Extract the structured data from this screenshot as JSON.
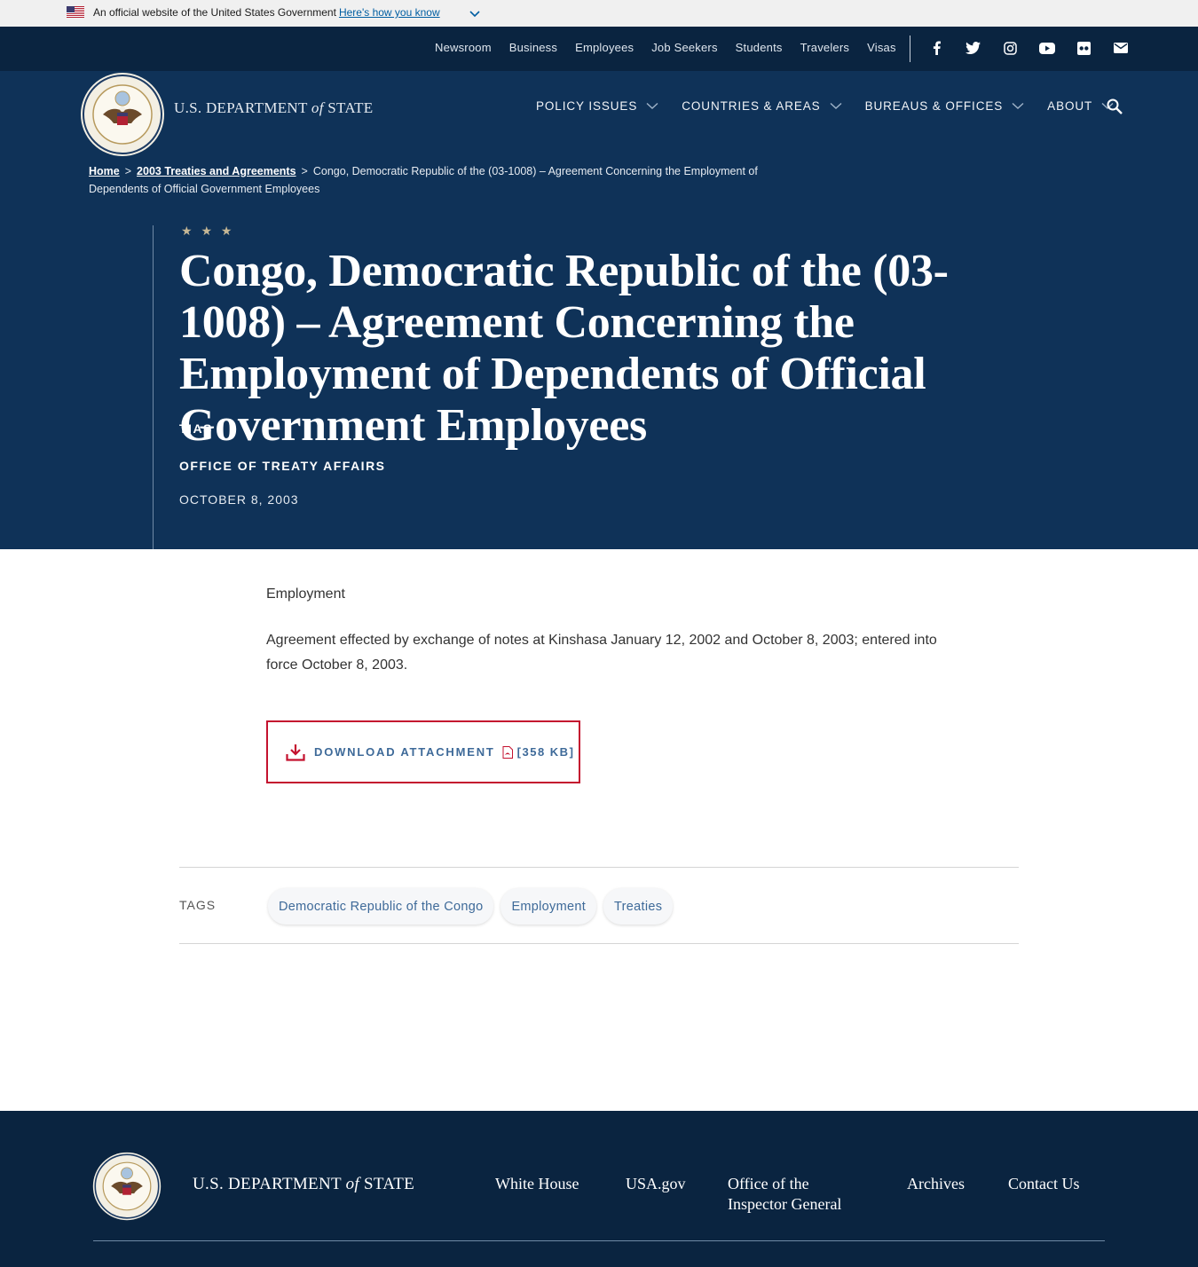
{
  "banner": {
    "text": "An official website of the United States Government",
    "link": "Here's how you know"
  },
  "utility_nav": [
    "Newsroom",
    "Business",
    "Employees",
    "Job Seekers",
    "Students",
    "Travelers",
    "Visas"
  ],
  "social_icons": [
    "facebook-icon",
    "twitter-icon",
    "instagram-icon",
    "youtube-icon",
    "flickr-icon",
    "email-icon"
  ],
  "brand": {
    "prefix": "U.S. DEPARTMENT ",
    "of": "of",
    "suffix": " STATE"
  },
  "main_nav": [
    "POLICY ISSUES",
    "COUNTRIES & AREAS",
    "BUREAUS & OFFICES",
    "ABOUT"
  ],
  "breadcrumb": {
    "home": "Home",
    "parent": "2003 Treaties and Agreements",
    "current": "Congo, Democratic Republic of the (03-1008) – Agreement Concerning the Employment of Dependents of Official Government Employees"
  },
  "article": {
    "stars": "★ ★ ★",
    "title": "Congo, Democratic Republic of the (03-1008) – Agreement Concerning the Employment of Dependents of Official Government Employees",
    "tag_line": "TIAS",
    "office": "OFFICE OF TREATY AFFAIRS",
    "date": "OCTOBER 8, 2003",
    "category": "Employment",
    "description": "Agreement effected by exchange of notes at Kinshasa January 12, 2002 and October 8, 2003; entered into force October 8, 2003."
  },
  "download": {
    "label": "DOWNLOAD ATTACHMENT",
    "size": "[358 KB]"
  },
  "tags": {
    "label": "TAGS",
    "items": [
      "Democratic Republic of the Congo",
      "Employment",
      "Treaties"
    ]
  },
  "footer": {
    "brand": {
      "prefix": "U.S. DEPARTMENT ",
      "of": "of",
      "suffix": " STATE"
    },
    "links": [
      "White House",
      "USA.gov",
      "Office of the Inspector General",
      "Archives",
      "Contact Us"
    ]
  },
  "colors": {
    "navy": "#0f3258",
    "dark_navy": "#0a2440",
    "accent_red": "#c4122f",
    "link_blue": "#3e6a99"
  }
}
